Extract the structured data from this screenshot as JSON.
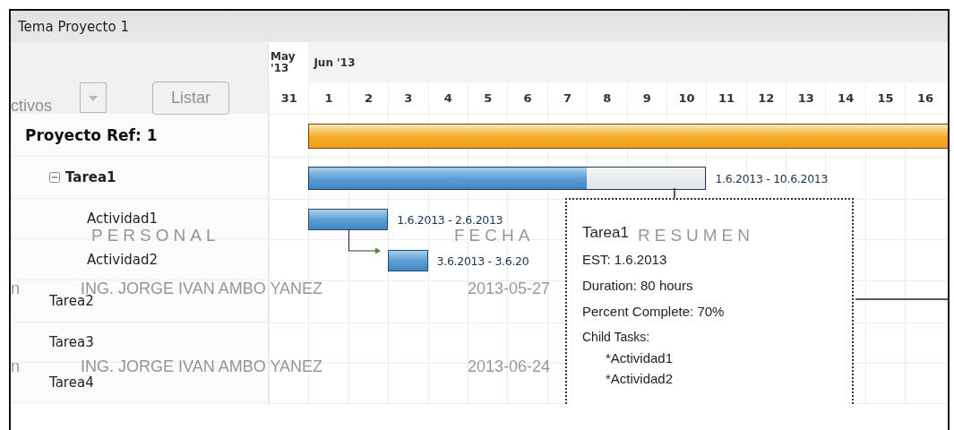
{
  "window": {
    "title": "Tema Proyecto 1"
  },
  "background_page": {
    "filter_value": "ctivos",
    "list_button": "Listar",
    "column_headers": [
      "PERSONAL",
      "FECHA",
      "RESUMEN"
    ],
    "rows": [
      {
        "column_1": "n",
        "personal": "ING. JORGE IVAN AMBO YANEZ",
        "fecha": "2013-05-27"
      },
      {
        "column_1": "n",
        "personal": "ING. JORGE IVAN AMBO YANEZ",
        "fecha": "2013-06-24"
      }
    ]
  },
  "timeline": {
    "days": [
      {
        "day": "31",
        "month": "May '13"
      },
      {
        "day": "1",
        "month": "Jun '13"
      },
      {
        "day": "2"
      },
      {
        "day": "3"
      },
      {
        "day": "4"
      },
      {
        "day": "5"
      },
      {
        "day": "6"
      },
      {
        "day": "7"
      },
      {
        "day": "8"
      },
      {
        "day": "9"
      },
      {
        "day": "10"
      },
      {
        "day": "11"
      },
      {
        "day": "12"
      },
      {
        "day": "13"
      },
      {
        "day": "14"
      },
      {
        "day": "15"
      },
      {
        "day": "16"
      }
    ]
  },
  "tasks": [
    {
      "name": "Proyecto Ref: 1",
      "kind": "project",
      "bar": {
        "open_end": true
      },
      "children": [
        {
          "name": "Tarea1",
          "kind": "task",
          "expanded": true,
          "bar": {
            "level": 0.7,
            "dates": "1.6.2013 - 10.6.2013"
          },
          "children": [
            {
              "name": "Actividad1",
              "kind": "activity",
              "bar": {
                "level": 1,
                "dates": "1.6.2013 - 2.6.2013",
                "successor_link": true
              }
            },
            {
              "name": "Actividad2",
              "kind": "activity",
              "bar": {
                "level": 1,
                "dates": "3.6.2013 - 3.6.20"
              }
            }
          ]
        },
        {
          "name": "Tarea2",
          "kind": "task"
        },
        {
          "name": "Tarea3",
          "kind": "task"
        },
        {
          "name": "Tarea4",
          "kind": "task"
        }
      ]
    }
  ],
  "tooltip": {
    "title": "Tarea1",
    "lines": [
      "EST: 1.6.2013",
      "Duration: 80 hours",
      "Percent Complete: 70%",
      "Child Tasks:"
    ],
    "child_items": [
      "*Actividad1",
      "*Actividad2"
    ]
  }
}
